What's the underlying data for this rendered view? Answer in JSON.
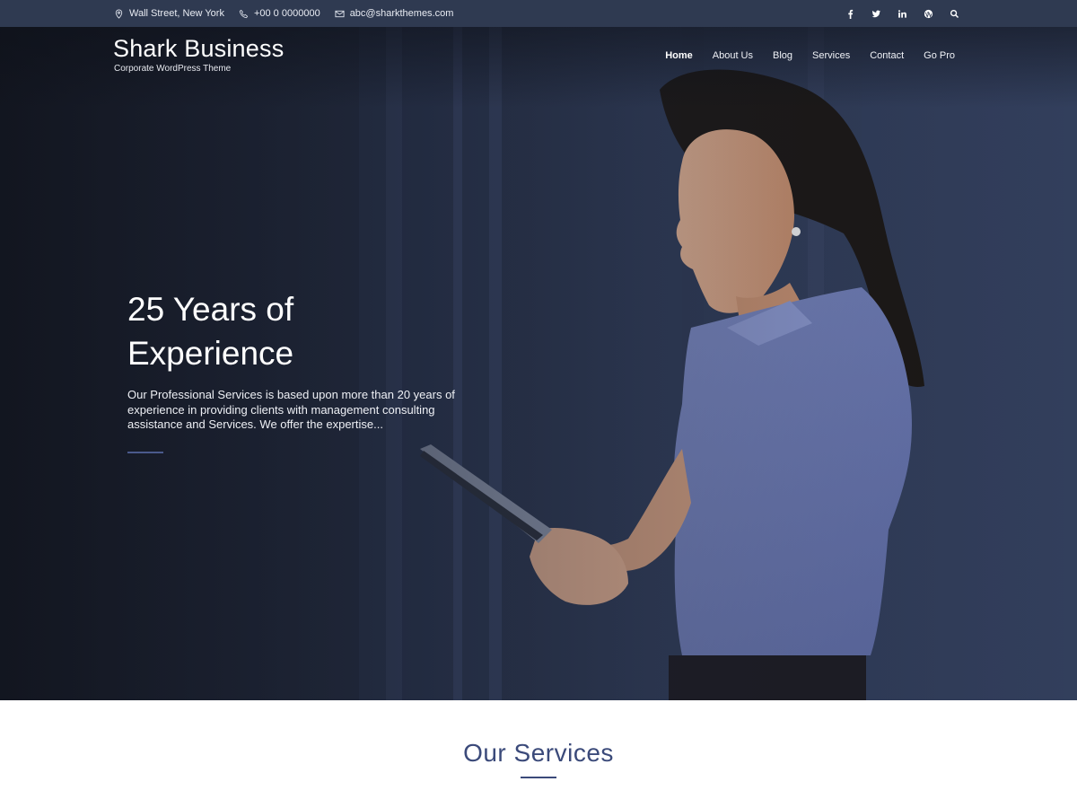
{
  "topbar": {
    "address": "Wall Street, New York",
    "phone": "+00 0 0000000",
    "email": "abc@sharkthemes.com",
    "social": [
      {
        "icon": "facebook-icon",
        "glyph": "f"
      },
      {
        "icon": "twitter-icon",
        "glyph": "t"
      },
      {
        "icon": "linkedin-icon",
        "glyph": "in"
      },
      {
        "icon": "wordpress-icon",
        "glyph": "W"
      },
      {
        "icon": "search-icon",
        "glyph": "search"
      }
    ]
  },
  "header": {
    "site_title": "Shark Business",
    "tagline": "Corporate WordPress Theme",
    "nav": [
      "Home",
      "About Us",
      "Blog",
      "Services",
      "Contact",
      "Go Pro"
    ],
    "active_nav": "Home"
  },
  "hero": {
    "title_line1": "25 Years of",
    "title_line2": "Experience",
    "description": "Our Professional Services is based upon more than 20 years of experience in providing clients with management consulting assistance and Services. We offer the expertise..."
  },
  "services": {
    "title": "Our Services"
  },
  "colors": {
    "topbar_bg": "#2f3a51",
    "accent": "#3b4a7a",
    "hero_dark": "#1a1f2e"
  }
}
